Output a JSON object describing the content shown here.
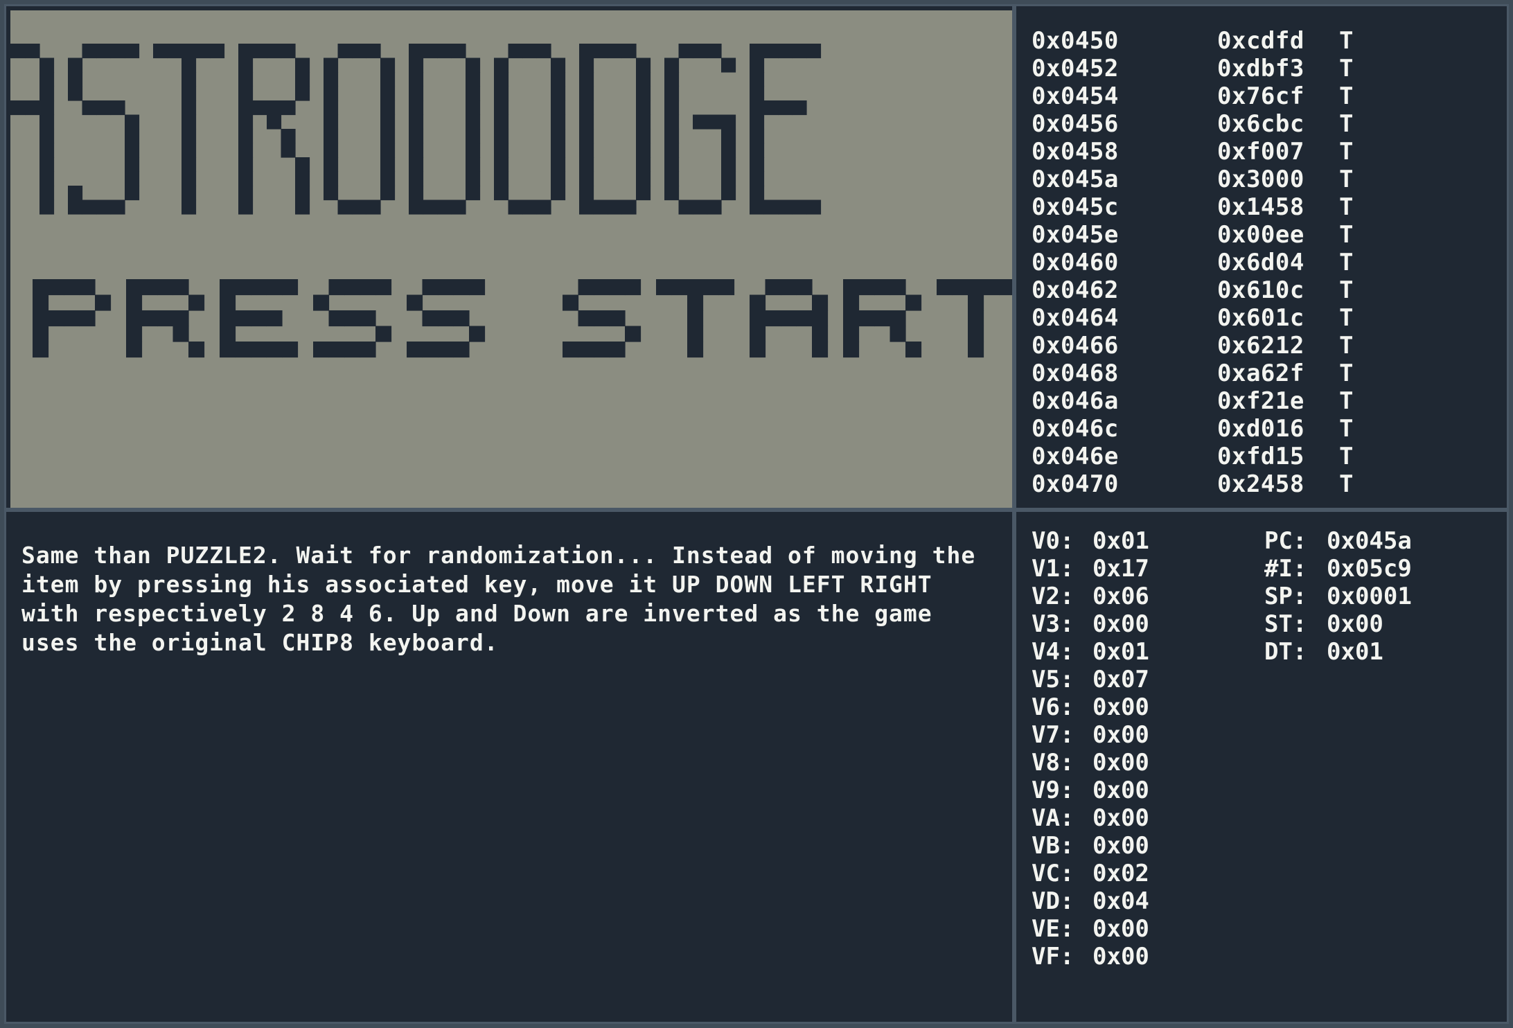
{
  "screen": {
    "title_art": "ASTRODODGE",
    "prompt_text": "PRESS START",
    "colors": {
      "background": "#8b8d81",
      "pixel": "#1f2833"
    }
  },
  "disassembly": [
    {
      "addr": "0x0450",
      "op": "0xcdfd",
      "flag": "T"
    },
    {
      "addr": "0x0452",
      "op": "0xdbf3",
      "flag": "T"
    },
    {
      "addr": "0x0454",
      "op": "0x76cf",
      "flag": "T"
    },
    {
      "addr": "0x0456",
      "op": "0x6cbc",
      "flag": "T"
    },
    {
      "addr": "0x0458",
      "op": "0xf007",
      "flag": "T"
    },
    {
      "addr": "0x045a",
      "op": "0x3000",
      "flag": "T"
    },
    {
      "addr": "0x045c",
      "op": "0x1458",
      "flag": "T"
    },
    {
      "addr": "0x045e",
      "op": "0x00ee",
      "flag": "T"
    },
    {
      "addr": "0x0460",
      "op": "0x6d04",
      "flag": "T"
    },
    {
      "addr": "0x0462",
      "op": "0x610c",
      "flag": "T"
    },
    {
      "addr": "0x0464",
      "op": "0x601c",
      "flag": "T"
    },
    {
      "addr": "0x0466",
      "op": "0x6212",
      "flag": "T"
    },
    {
      "addr": "0x0468",
      "op": "0xa62f",
      "flag": "T"
    },
    {
      "addr": "0x046a",
      "op": "0xf21e",
      "flag": "T"
    },
    {
      "addr": "0x046c",
      "op": "0xd016",
      "flag": "T"
    },
    {
      "addr": "0x046e",
      "op": "0xfd15",
      "flag": "T"
    },
    {
      "addr": "0x0470",
      "op": "0x2458",
      "flag": "T"
    }
  ],
  "description": "Same than PUZZLE2. Wait for randomization... Instead of moving the item by pressing his associated key, move it UP DOWN LEFT RIGHT with respectively 2 8 4 6. Up and Down are inverted as the game uses the original CHIP8 keyboard.",
  "registers": [
    {
      "name": "V0:",
      "value": "0x01"
    },
    {
      "name": "V1:",
      "value": "0x17"
    },
    {
      "name": "V2:",
      "value": "0x06"
    },
    {
      "name": "V3:",
      "value": "0x00"
    },
    {
      "name": "V4:",
      "value": "0x01"
    },
    {
      "name": "V5:",
      "value": "0x07"
    },
    {
      "name": "V6:",
      "value": "0x00"
    },
    {
      "name": "V7:",
      "value": "0x00"
    },
    {
      "name": "V8:",
      "value": "0x00"
    },
    {
      "name": "V9:",
      "value": "0x00"
    },
    {
      "name": "VA:",
      "value": "0x00"
    },
    {
      "name": "VB:",
      "value": "0x00"
    },
    {
      "name": "VC:",
      "value": "0x02"
    },
    {
      "name": "VD:",
      "value": "0x04"
    },
    {
      "name": "VE:",
      "value": "0x00"
    },
    {
      "name": "VF:",
      "value": "0x00"
    }
  ],
  "special_registers": [
    {
      "name": "PC:",
      "value": "0x045a"
    },
    {
      "name": "#I:",
      "value": "0x05c9"
    },
    {
      "name": "SP:",
      "value": "0x0001"
    },
    {
      "name": "ST:",
      "value": "0x00"
    },
    {
      "name": "DT:",
      "value": "0x01"
    }
  ]
}
